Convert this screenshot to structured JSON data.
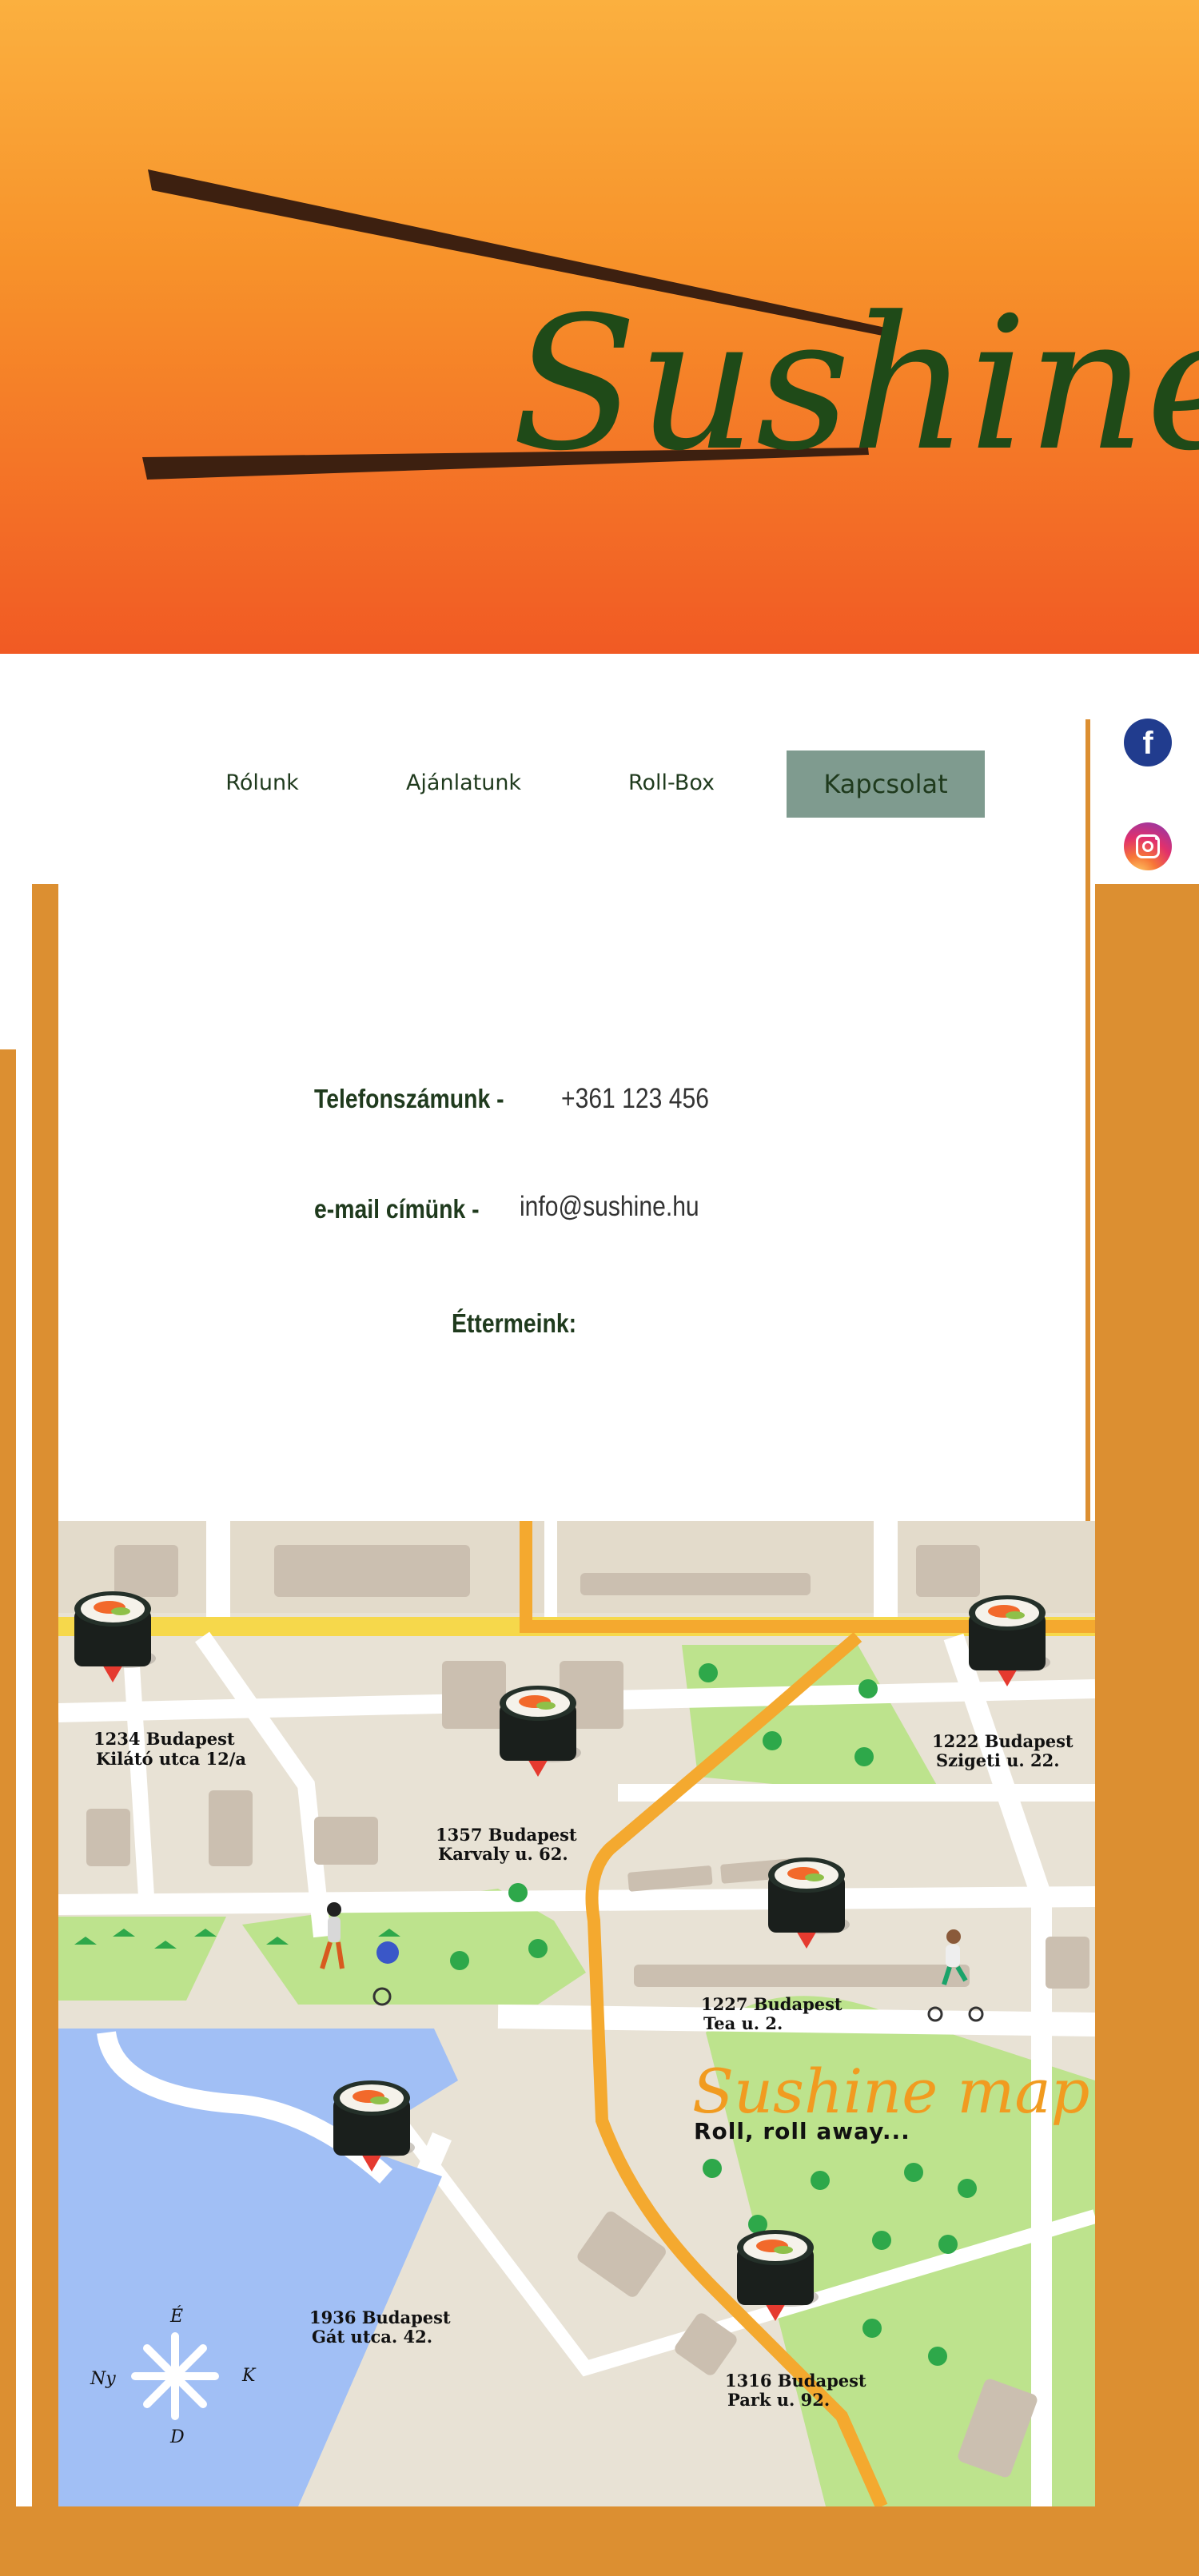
{
  "brand": {
    "logo_text": "Sushine"
  },
  "nav": {
    "items": [
      "Rólunk",
      "Ajánlatunk",
      "Roll-Box"
    ],
    "contact": "Kapcsolat"
  },
  "social": {
    "facebook_icon": "facebook-icon",
    "instagram_icon": "instagram-icon"
  },
  "contact": {
    "phone_label": "Telefonszámunk -",
    "phone_value": "+361 123 456",
    "email_label": "e-mail címünk -",
    "email_value": "info@sushine.hu",
    "restaurants_label": "Éttermeink:"
  },
  "map": {
    "title": "Sushine map",
    "subtitle": "Roll, roll away...",
    "compass": {
      "north": "É",
      "west": "Ny",
      "east": "K",
      "south": "D"
    },
    "locations": [
      {
        "line1": "1234 Budapest",
        "line2": "Kilátó utca 12/a"
      },
      {
        "line1": "1357 Budapest",
        "line2": "Karvaly u. 62."
      },
      {
        "line1": "1222 Budapest",
        "line2": "Szigeti u. 22."
      },
      {
        "line1": "1227 Budapest",
        "line2": "Tea u. 2."
      },
      {
        "line1": "1936 Budapest",
        "line2": "Gát utca. 42."
      },
      {
        "line1": "1316 Budapest",
        "line2": "Park u. 92."
      }
    ]
  },
  "colors": {
    "hero_top": "#fbb03f",
    "hero_bottom": "#f15a24",
    "accent": "#dc8f31",
    "text_dark": "#1f3a1d",
    "button_bg": "#7f9b8f"
  }
}
